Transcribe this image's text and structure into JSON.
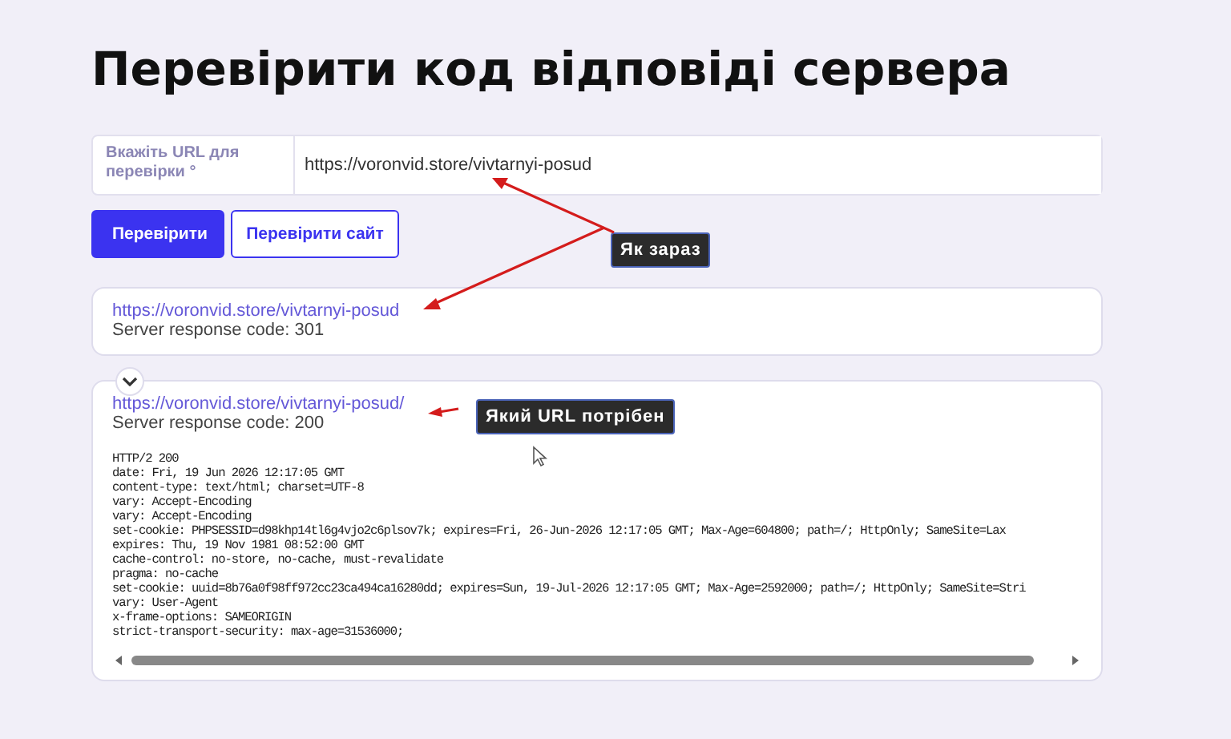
{
  "title": "Перевірити код відповіді сервера",
  "url_field": {
    "label": "Вкажіть URL для перевірки °",
    "value": "https://voronvid.store/vivtarnyi-posud"
  },
  "buttons": [
    {
      "label": "Перевірити",
      "kind": "primary"
    },
    {
      "label": "Перевірити сайт",
      "kind": "secondary"
    }
  ],
  "results": [
    {
      "url": "https://voronvid.store/vivtarnyi-posud",
      "code_text": "Server response code: 301"
    },
    {
      "url": "https://voronvid.store/vivtarnyi-posud/",
      "code_text": "Server response code: 200",
      "headers": [
        "HTTP/2 200",
        "date: Fri, 19 Jun 2026 12:17:05 GMT",
        "content-type: text/html; charset=UTF-8",
        "vary: Accept-Encoding",
        "vary: Accept-Encoding",
        "set-cookie: PHPSESSID=d98khp14tl6g4vjo2c6plsov7k; expires=Fri, 26-Jun-2026 12:17:05 GMT; Max-Age=604800; path=/; HttpOnly; SameSite=Lax",
        "expires: Thu, 19 Nov 1981 08:52:00 GMT",
        "cache-control: no-store, no-cache, must-revalidate",
        "pragma: no-cache",
        "set-cookie: uuid=8b76a0f98ff972cc23ca494ca16280dd; expires=Sun, 19-Jul-2026 12:17:05 GMT; Max-Age=2592000; path=/; HttpOnly; SameSite=Stri",
        "vary: User-Agent",
        "x-frame-options: SAMEORIGIN",
        "strict-transport-security: max-age=31536000;"
      ]
    }
  ],
  "annotations": [
    {
      "text": "Як зараз"
    },
    {
      "text": "Який URL потрібен"
    }
  ]
}
